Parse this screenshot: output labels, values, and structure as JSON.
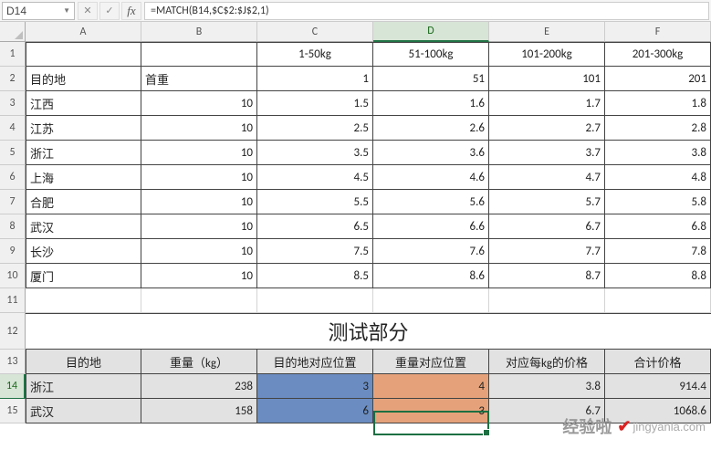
{
  "cell_ref": "D14",
  "formula": "=MATCH(B14,$C$2:$J$2,1)",
  "col_headers": [
    "A",
    "B",
    "C",
    "D",
    "E",
    "F"
  ],
  "row_headers": [
    "1",
    "2",
    "3",
    "4",
    "5",
    "6",
    "7",
    "8",
    "9",
    "10",
    "11",
    "12",
    "13",
    "14",
    "15"
  ],
  "grid": {
    "r1": {
      "C": "1-50kg",
      "D": "51-100kg",
      "E": "101-200kg",
      "F": "201-300kg"
    },
    "r2": {
      "A": "目的地",
      "B": "首重",
      "C": "1",
      "D": "51",
      "E": "101",
      "F": "201"
    },
    "r3": {
      "A": "江西",
      "B": "10",
      "C": "1.5",
      "D": "1.6",
      "E": "1.7",
      "F": "1.8"
    },
    "r4": {
      "A": "江苏",
      "B": "10",
      "C": "2.5",
      "D": "2.6",
      "E": "2.7",
      "F": "2.8"
    },
    "r5": {
      "A": "浙江",
      "B": "10",
      "C": "3.5",
      "D": "3.6",
      "E": "3.7",
      "F": "3.8"
    },
    "r6": {
      "A": "上海",
      "B": "10",
      "C": "4.5",
      "D": "4.6",
      "E": "4.7",
      "F": "4.8"
    },
    "r7": {
      "A": "合肥",
      "B": "10",
      "C": "5.5",
      "D": "5.6",
      "E": "5.7",
      "F": "5.8"
    },
    "r8": {
      "A": "武汉",
      "B": "10",
      "C": "6.5",
      "D": "6.6",
      "E": "6.7",
      "F": "6.8"
    },
    "r9": {
      "A": "长沙",
      "B": "10",
      "C": "7.5",
      "D": "7.6",
      "E": "7.7",
      "F": "7.8"
    },
    "r10": {
      "A": "厦门",
      "B": "10",
      "C": "8.5",
      "D": "8.6",
      "E": "8.7",
      "F": "8.8"
    }
  },
  "title": "测试部分",
  "header13": {
    "A": "目的地",
    "B": "重量（kg）",
    "C": "目的地对应位置",
    "D": "重量对应位置",
    "E": "对应每kg的价格",
    "F": "合计价格"
  },
  "r14": {
    "A": "浙江",
    "B": "238",
    "C": "3",
    "D": "4",
    "E": "3.8",
    "F": "914.4"
  },
  "r15": {
    "A": "武汉",
    "B": "158",
    "C": "6",
    "D": "3",
    "E": "6.7",
    "F": "1068.6"
  },
  "watermark": {
    "brand": "经验啦",
    "check": "✔",
    "url": "jingyanla.com"
  }
}
